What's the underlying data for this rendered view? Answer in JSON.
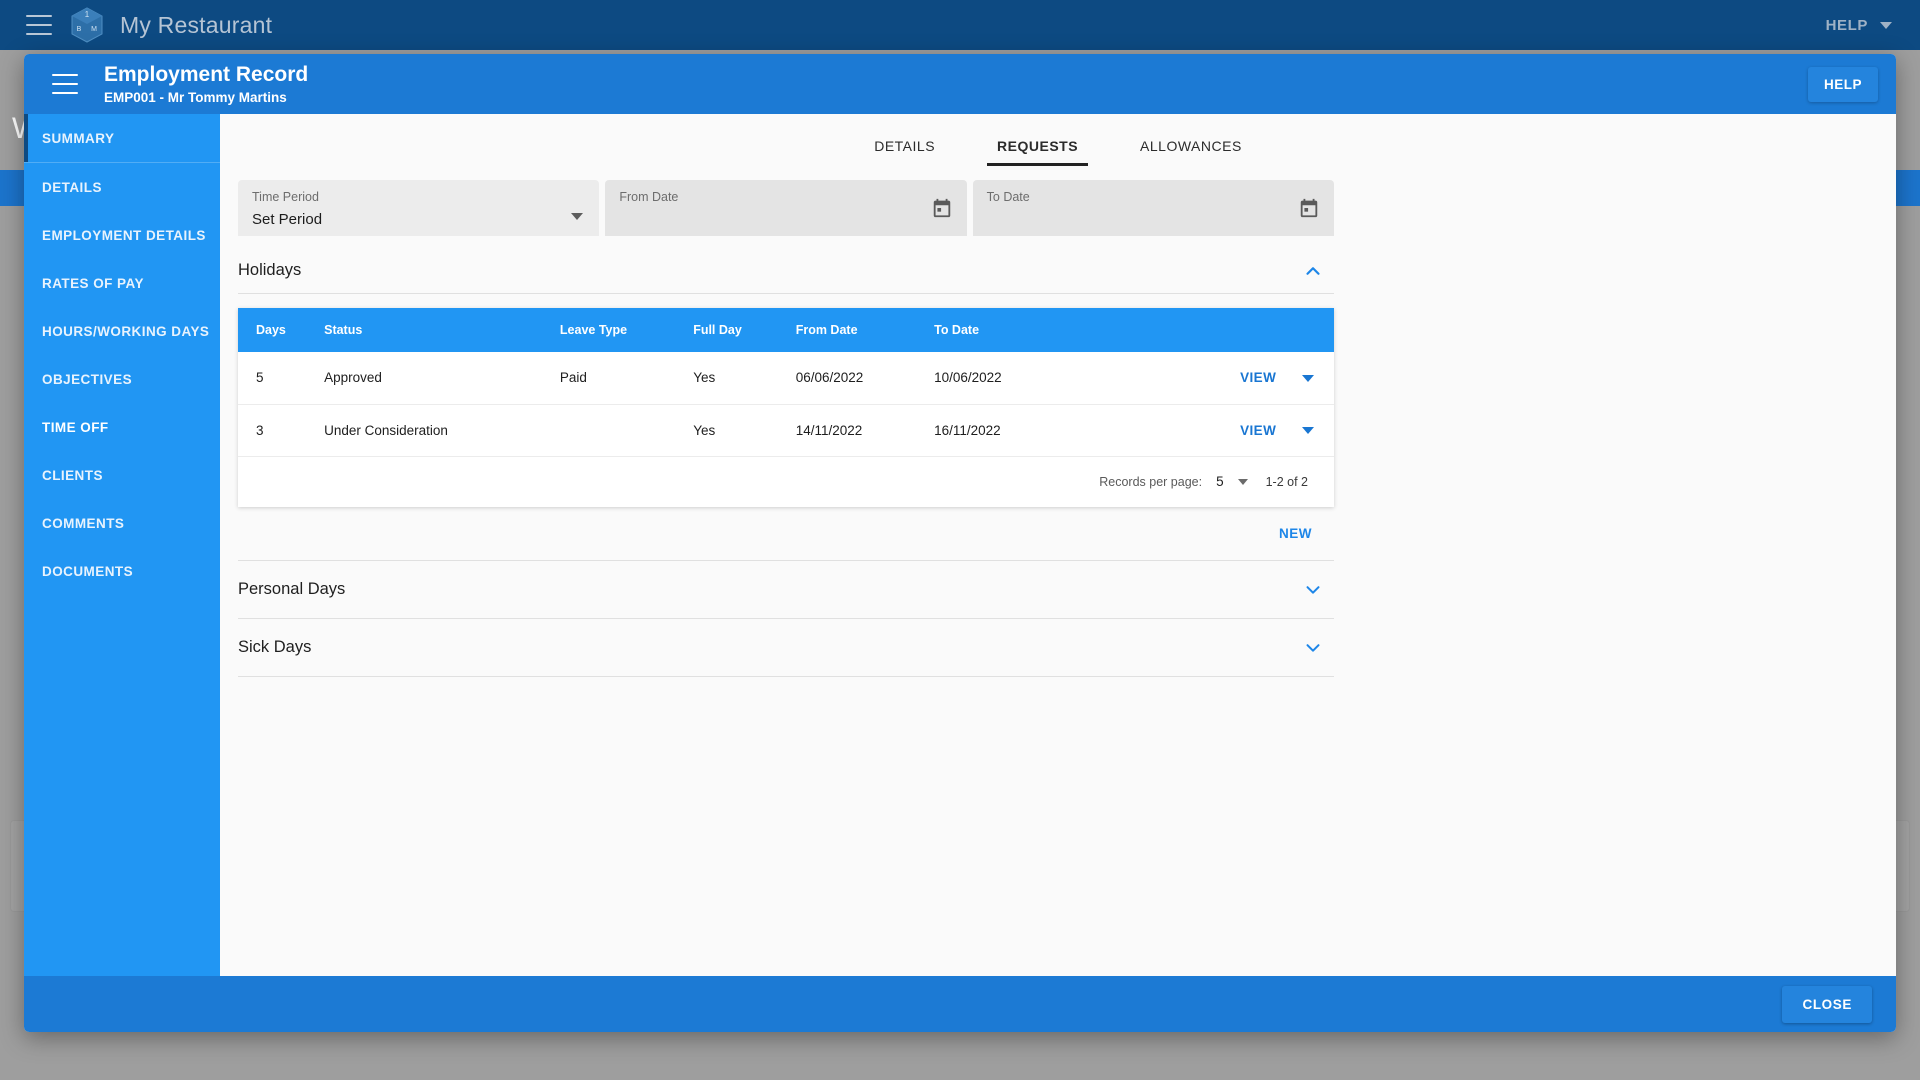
{
  "appbar": {
    "menu_icon": "hamburger-icon",
    "logo_icon": "cube-logo-icon",
    "brand": "My Restaurant",
    "help_label": "HELP",
    "help_caret_icon": "chevron-down-icon"
  },
  "background": {
    "letter": "W"
  },
  "modal": {
    "menu_icon": "hamburger-icon",
    "title": "Employment Record",
    "subtitle": "EMP001 - Mr Tommy Martins",
    "help_label": "HELP",
    "close_label": "CLOSE"
  },
  "sidebar": {
    "items": [
      {
        "label": "SUMMARY",
        "current": false
      },
      {
        "label": "DETAILS",
        "current": false
      },
      {
        "label": "EMPLOYMENT DETAILS",
        "current": false
      },
      {
        "label": "RATES OF PAY",
        "current": false
      },
      {
        "label": "HOURS/WORKING DAYS",
        "current": false
      },
      {
        "label": "OBJECTIVES",
        "current": false
      },
      {
        "label": "TIME OFF",
        "current": true
      },
      {
        "label": "CLIENTS",
        "current": false
      },
      {
        "label": "COMMENTS",
        "current": false
      },
      {
        "label": "DOCUMENTS",
        "current": false
      }
    ]
  },
  "tabs": [
    {
      "label": "DETAILS",
      "active": false
    },
    {
      "label": "REQUESTS",
      "active": true
    },
    {
      "label": "ALLOWANCES",
      "active": false
    }
  ],
  "filters": {
    "time_period": {
      "label": "Time Period",
      "value": "Set Period",
      "icon": "chevron-down-icon"
    },
    "from_date": {
      "label": "From Date",
      "value": "",
      "icon": "calendar-icon"
    },
    "to_date": {
      "label": "To Date",
      "value": "",
      "icon": "calendar-icon"
    }
  },
  "sections": [
    {
      "title": "Holidays",
      "expanded": true,
      "icon": "chevron-up-icon"
    },
    {
      "title": "Personal Days",
      "expanded": false,
      "icon": "chevron-down-icon"
    },
    {
      "title": "Sick Days",
      "expanded": false,
      "icon": "chevron-down-icon"
    }
  ],
  "table": {
    "columns": [
      "Days",
      "Status",
      "Leave Type",
      "Full Day",
      "From Date",
      "To Date"
    ],
    "rows": [
      {
        "days": "5",
        "status": "Approved",
        "leave_type": "Paid",
        "full_day": "Yes",
        "from_date": "06/06/2022",
        "to_date": "10/06/2022",
        "action_label": "VIEW",
        "action_caret_icon": "chevron-down-icon"
      },
      {
        "days": "3",
        "status": "Under Consideration",
        "leave_type": "",
        "full_day": "Yes",
        "from_date": "14/11/2022",
        "to_date": "16/11/2022",
        "action_label": "VIEW",
        "action_caret_icon": "chevron-down-icon"
      }
    ]
  },
  "paginator": {
    "records_label": "Records per page:",
    "records_value": "5",
    "caret_icon": "chevron-down-icon",
    "range": "1-2 of 2"
  },
  "actions": {
    "new_label": "NEW"
  },
  "colors": {
    "appbar": "#0d4a82",
    "modal_header": "#1c7ad4",
    "sidebar": "#2196f3",
    "accent_blue": "#1976d2",
    "table_header": "#2196f3"
  }
}
